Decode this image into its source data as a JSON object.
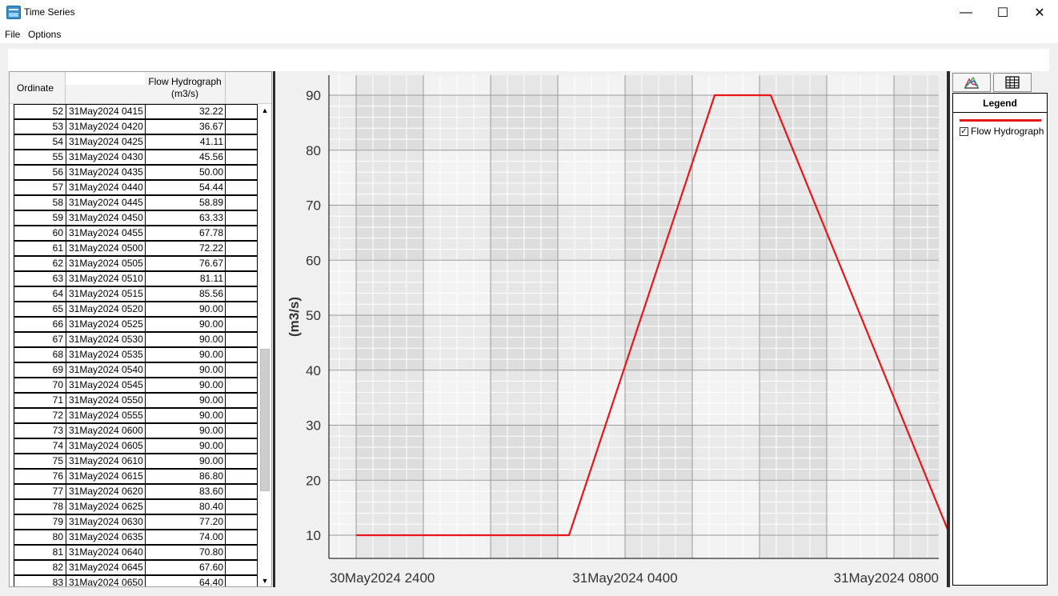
{
  "window": {
    "title": "Time Series",
    "controls": {
      "minimize": "—",
      "maximize": "☐",
      "close": "✕"
    }
  },
  "menu": {
    "file": "File",
    "options": "Options"
  },
  "table": {
    "headers": {
      "ordinate": "Ordinate",
      "date": "",
      "flow": "Flow Hydrograph\n(m3/s)"
    },
    "rows": [
      {
        "ord": "52",
        "date": "31May2024 0415",
        "flow": "32.22"
      },
      {
        "ord": "53",
        "date": "31May2024 0420",
        "flow": "36.67"
      },
      {
        "ord": "54",
        "date": "31May2024 0425",
        "flow": "41.11"
      },
      {
        "ord": "55",
        "date": "31May2024 0430",
        "flow": "45.56"
      },
      {
        "ord": "56",
        "date": "31May2024 0435",
        "flow": "50.00"
      },
      {
        "ord": "57",
        "date": "31May2024 0440",
        "flow": "54.44"
      },
      {
        "ord": "58",
        "date": "31May2024 0445",
        "flow": "58.89"
      },
      {
        "ord": "59",
        "date": "31May2024 0450",
        "flow": "63.33"
      },
      {
        "ord": "60",
        "date": "31May2024 0455",
        "flow": "67.78"
      },
      {
        "ord": "61",
        "date": "31May2024 0500",
        "flow": "72.22"
      },
      {
        "ord": "62",
        "date": "31May2024 0505",
        "flow": "76.67"
      },
      {
        "ord": "63",
        "date": "31May2024 0510",
        "flow": "81.11"
      },
      {
        "ord": "64",
        "date": "31May2024 0515",
        "flow": "85.56"
      },
      {
        "ord": "65",
        "date": "31May2024 0520",
        "flow": "90.00"
      },
      {
        "ord": "66",
        "date": "31May2024 0525",
        "flow": "90.00"
      },
      {
        "ord": "67",
        "date": "31May2024 0530",
        "flow": "90.00"
      },
      {
        "ord": "68",
        "date": "31May2024 0535",
        "flow": "90.00"
      },
      {
        "ord": "69",
        "date": "31May2024 0540",
        "flow": "90.00"
      },
      {
        "ord": "70",
        "date": "31May2024 0545",
        "flow": "90.00"
      },
      {
        "ord": "71",
        "date": "31May2024 0550",
        "flow": "90.00"
      },
      {
        "ord": "72",
        "date": "31May2024 0555",
        "flow": "90.00"
      },
      {
        "ord": "73",
        "date": "31May2024 0600",
        "flow": "90.00"
      },
      {
        "ord": "74",
        "date": "31May2024 0605",
        "flow": "90.00"
      },
      {
        "ord": "75",
        "date": "31May2024 0610",
        "flow": "90.00"
      },
      {
        "ord": "76",
        "date": "31May2024 0615",
        "flow": "86.80"
      },
      {
        "ord": "77",
        "date": "31May2024 0620",
        "flow": "83.60"
      },
      {
        "ord": "78",
        "date": "31May2024 0625",
        "flow": "80.40"
      },
      {
        "ord": "79",
        "date": "31May2024 0630",
        "flow": "77.20"
      },
      {
        "ord": "80",
        "date": "31May2024 0635",
        "flow": "74.00"
      },
      {
        "ord": "81",
        "date": "31May2024 0640",
        "flow": "70.80"
      },
      {
        "ord": "82",
        "date": "31May2024 0645",
        "flow": "67.60"
      },
      {
        "ord": "83",
        "date": "31May2024 0650",
        "flow": "64.40"
      }
    ]
  },
  "legend": {
    "title": "Legend",
    "entry": "Flow Hydrograph",
    "checked": true,
    "chart_button_icon": "chart-icon",
    "table_button_icon": "table-icon"
  },
  "colors": {
    "series": "#e8161b"
  },
  "chart_data": {
    "type": "line",
    "ylabel": "(m3/s)",
    "ylim": [
      10,
      90
    ],
    "yticks": [
      10,
      20,
      30,
      40,
      50,
      60,
      70,
      80,
      90
    ],
    "xtick_labels": [
      "30May2024 2400",
      "31May2024 0400",
      "31May2024 0800"
    ],
    "grid": true,
    "series": [
      {
        "name": "Flow Hydrograph",
        "points": [
          [
            "31May2024 0000",
            10
          ],
          [
            "31May2024 0310",
            10
          ],
          [
            "31May2024 0520",
            90
          ],
          [
            "31May2024 0610",
            90
          ],
          [
            "31May2024 0850",
            10
          ]
        ]
      }
    ]
  }
}
